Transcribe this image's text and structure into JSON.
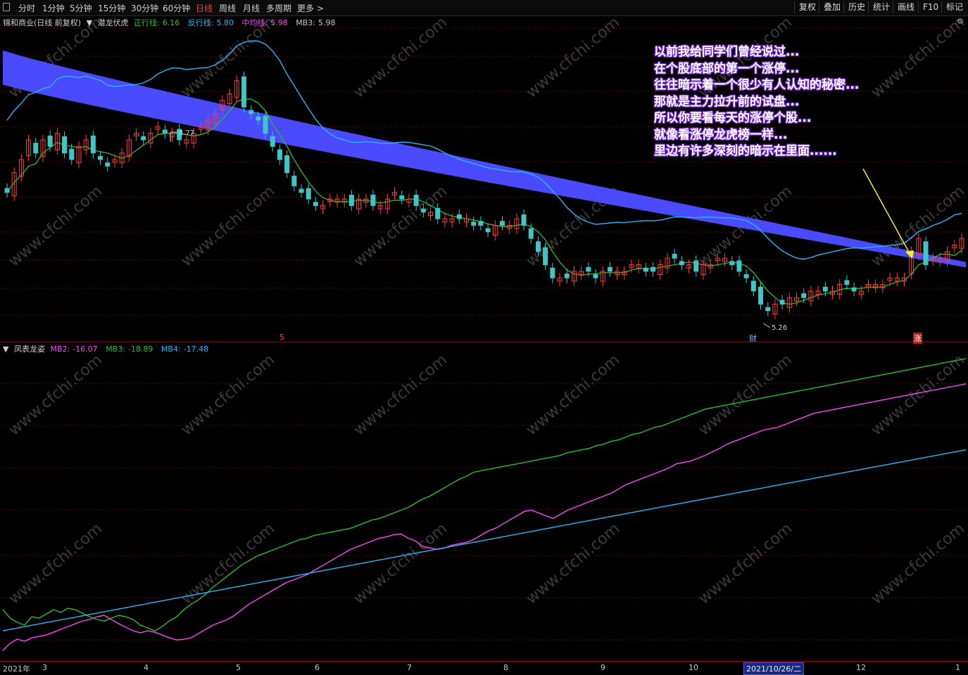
{
  "toolbar": {
    "periods": [
      "分时",
      "1分钟",
      "5分钟",
      "15分钟",
      "30分钟",
      "60分钟",
      "日线",
      "周线",
      "月线",
      "多周期",
      "更多 >"
    ],
    "active_period": "日线",
    "right_buttons": [
      "复权",
      "叠加",
      "历史",
      "统计",
      "画线",
      "F10",
      "标记"
    ]
  },
  "main_legend": {
    "stock": "锦和商业(日线 前复权)",
    "indicator": "潜龙伏虎",
    "items": [
      {
        "label": "正行线:",
        "value": "6.16",
        "color": "#21c421"
      },
      {
        "label": "反行线:",
        "value": "5.80",
        "color": "#29b6f6"
      },
      {
        "label": "中均线:",
        "value": "5.98",
        "color": "#ff45ff"
      },
      {
        "label": "MB3:",
        "value": "5.98",
        "color": "#c8c8c8"
      }
    ]
  },
  "sub_legend": {
    "indicator": "凤表龙姿",
    "items": [
      {
        "label": "MB2:",
        "value": "-16.07",
        "color": "#ff45ff"
      },
      {
        "label": "MB3:",
        "value": "-18.89",
        "color": "#21c421"
      },
      {
        "label": "MB4:",
        "value": "-17.48",
        "color": "#29b6f6"
      }
    ]
  },
  "annotation": {
    "lines": [
      "以前我给同学们曾经说过...",
      "在个股底部的第一个涨停...",
      "往往暗示着一个很少有人认知的秘密...",
      "那就是主力拉升前的试盘...",
      "所以你要看每天的涨停个股...",
      "就像看涨停龙虎榜一样...",
      "里边有许多深刻的暗示在里面......"
    ],
    "arrow_color": "#f3f32a"
  },
  "markers": {
    "high_label": "8.77",
    "low_label": "5.26",
    "fin_label": "财",
    "zt_label": "涨",
    "s_label": "S"
  },
  "xaxis": {
    "ticks": [
      "2021年",
      "3",
      "4",
      "5",
      "6",
      "7",
      "8",
      "9",
      "10",
      "2021/10/26/二",
      "12",
      "1"
    ]
  },
  "watermark": "www.cfchi.com",
  "colors": {
    "up": "#ff3b3b",
    "down": "#3ec6c6",
    "band": "#4a4aff",
    "grid": "#7a0000"
  },
  "chart_data": [
    {
      "type": "candlestick",
      "title": "锦和商业(日线 前复权)",
      "overlays": [
        "正行线",
        "反行线",
        "中均线",
        "MB3"
      ],
      "price_range": [
        5.0,
        9.6
      ],
      "key_prices": {
        "high": 8.77,
        "low": 5.26
      },
      "close_series": [
        7.1,
        7.4,
        7.6,
        7.9,
        7.7,
        7.9,
        7.8,
        8.0,
        7.7,
        7.6,
        7.8,
        7.9,
        7.7,
        7.6,
        7.5,
        7.6,
        7.7,
        7.9,
        8.0,
        7.9,
        8.0,
        8.1,
        8.0,
        8.0,
        7.9,
        7.9,
        8.0,
        8.1,
        8.2,
        8.3,
        8.5,
        8.6,
        8.8,
        8.4,
        8.3,
        8.2,
        8.0,
        7.8,
        7.6,
        7.4,
        7.2,
        7.1,
        7.0,
        6.9,
        6.9,
        7.0,
        7.0,
        7.0,
        6.9,
        7.0,
        7.0,
        6.9,
        6.9,
        7.0,
        7.1,
        7.0,
        7.0,
        6.9,
        6.8,
        6.8,
        6.7,
        6.7,
        6.7,
        6.7,
        6.7,
        6.6,
        6.6,
        6.5,
        6.6,
        6.6,
        6.6,
        6.7,
        6.6,
        6.4,
        6.2,
        6.0,
        5.8,
        5.8,
        5.8,
        5.9,
        5.9,
        5.9,
        5.8,
        5.9,
        5.9,
        5.9,
        5.9,
        6.0,
        6.0,
        5.9,
        5.9,
        6.0,
        6.1,
        6.1,
        6.0,
        6.0,
        5.9,
        6.0,
        6.0,
        6.1,
        6.1,
        6.0,
        5.9,
        5.8,
        5.6,
        5.4,
        5.3,
        5.4,
        5.4,
        5.5,
        5.5,
        5.5,
        5.6,
        5.6,
        5.6,
        5.6,
        5.7,
        5.7,
        5.6,
        5.6,
        5.7,
        5.7,
        5.7,
        5.8,
        5.8,
        5.8,
        6.2,
        6.4,
        6.0,
        6.1,
        6.1,
        6.2,
        6.3,
        6.4
      ]
    },
    {
      "type": "line",
      "title": "凤表龙姿",
      "series": [
        {
          "name": "MB2",
          "color": "#ff45ff",
          "last": -16.07,
          "values": [
            -88,
            -78,
            -72,
            -75,
            -70,
            -68,
            -66,
            -62,
            -58,
            -54,
            -50,
            -46,
            -44,
            -40,
            -38,
            -44,
            -50,
            -55,
            -60,
            -63,
            -60,
            -62,
            -66,
            -70,
            -73,
            -72,
            -70,
            -64,
            -58,
            -52,
            -48,
            -44,
            -38,
            -30,
            -22,
            -16,
            -10,
            -4,
            2,
            8,
            12,
            16,
            20,
            26,
            32,
            38,
            44,
            50,
            56,
            60,
            64,
            68,
            72,
            74,
            77,
            78,
            72,
            68,
            60,
            58,
            56,
            58,
            62,
            64,
            66,
            70,
            76,
            82,
            86,
            92,
            98,
            104,
            110,
            112,
            108,
            104,
            100,
            106,
            112,
            116,
            120,
            124,
            128,
            132,
            136,
            142,
            148,
            152,
            156,
            160,
            164,
            168,
            172,
            178,
            180,
            182,
            186,
            190,
            195,
            200,
            206,
            210,
            214,
            218,
            222,
            226,
            228,
            230,
            234,
            238,
            242,
            246,
            250,
            252,
            254,
            256,
            258,
            260,
            262,
            264,
            266,
            268,
            270,
            272,
            274,
            276,
            278,
            280,
            282,
            284,
            286,
            288,
            290,
            292
          ]
        },
        {
          "name": "MB3",
          "color": "#21c421",
          "last": -18.89,
          "values": [
            -30,
            -42,
            -48,
            -52,
            -40,
            -42,
            -36,
            -30,
            -34,
            -28,
            -30,
            -35,
            -40,
            -44,
            -46,
            -42,
            -38,
            -40,
            -44,
            -52,
            -56,
            -60,
            -54,
            -46,
            -40,
            -30,
            -22,
            -16,
            -8,
            2,
            10,
            18,
            26,
            34,
            40,
            46,
            50,
            54,
            58,
            62,
            66,
            70,
            72,
            76,
            78,
            80,
            82,
            84,
            86,
            90,
            94,
            98,
            100,
            104,
            108,
            112,
            116,
            122,
            128,
            132,
            138,
            144,
            150,
            156,
            160,
            166,
            168,
            170,
            172,
            174,
            176,
            178,
            180,
            182,
            184,
            186,
            188,
            190,
            194,
            196,
            198,
            200,
            204,
            206,
            210,
            212,
            216,
            220,
            222,
            226,
            230,
            232,
            236,
            240,
            244,
            248,
            252,
            256,
            258,
            260,
            262,
            264,
            266,
            268,
            270,
            272,
            274,
            276,
            278,
            280,
            282,
            284,
            286,
            288,
            290,
            292,
            294,
            296,
            298,
            300,
            302,
            304,
            306,
            308,
            310,
            312,
            314,
            316,
            318,
            320,
            322,
            324,
            326,
            328
          ]
        },
        {
          "name": "MB4",
          "color": "#29b6f6",
          "last": -17.48,
          "values": [
            -60,
            -58,
            -56,
            -54,
            -52,
            -50,
            -48,
            -46,
            -44,
            -42,
            -40,
            -38,
            -36,
            -34,
            -32,
            -30,
            -28,
            -26,
            -24,
            -22,
            -20,
            -18,
            -16,
            -14,
            -12,
            -10,
            -8,
            -6,
            -4,
            -2,
            0,
            2,
            4,
            6,
            8,
            10,
            12,
            14,
            16,
            18,
            20,
            22,
            24,
            26,
            28,
            30,
            32,
            34,
            36,
            38,
            40,
            42,
            44,
            46,
            48,
            50,
            52,
            54,
            56,
            58,
            60,
            62,
            64,
            66,
            68,
            70,
            72,
            74,
            76,
            78,
            80,
            82,
            84,
            86,
            88,
            90,
            92,
            94,
            96,
            98,
            100,
            102,
            104,
            106,
            108,
            110,
            112,
            114,
            116,
            118,
            120,
            122,
            124,
            126,
            128,
            130,
            132,
            134,
            136,
            138,
            140,
            142,
            144,
            146,
            148,
            150,
            152,
            154,
            156,
            158,
            160,
            162,
            164,
            166,
            168,
            170,
            172,
            174,
            176,
            178,
            180,
            182,
            184,
            186,
            188,
            190,
            192,
            194,
            196,
            198
          ]
        }
      ]
    }
  ]
}
